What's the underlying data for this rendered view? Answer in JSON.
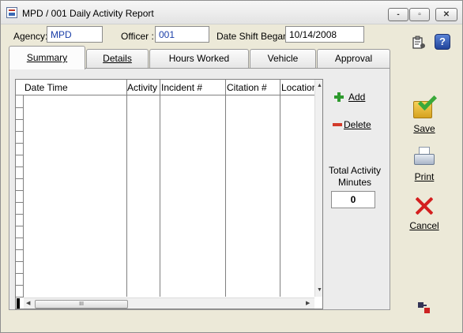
{
  "window": {
    "title": "MPD / 001 Daily Activity Report",
    "controls": {
      "minimize": "-",
      "maximize": "▫",
      "close": "✕"
    }
  },
  "header": {
    "agency_label": "Agency:",
    "agency_value": "MPD",
    "officer_label": "Officer :",
    "officer_value": "001",
    "date_label": "Date Shift Began :",
    "date_value": "10/14/2008"
  },
  "tabs": [
    {
      "label": "Summary",
      "active": true
    },
    {
      "label": "Details"
    },
    {
      "label": "Hours Worked"
    },
    {
      "label": "Vehicle"
    },
    {
      "label": "Approval"
    }
  ],
  "grid": {
    "columns": [
      "Date  Time",
      "Activity",
      "Incident #",
      "Citation #",
      "Location"
    ],
    "rows": [],
    "hscroll_thumb": "III"
  },
  "actions": {
    "add_label": "Add",
    "delete_label": "Delete"
  },
  "totals": {
    "label": "Total Activity Minutes",
    "value": "0"
  },
  "toolbar": {
    "save_label": "Save",
    "print_label": "Print",
    "cancel_label": "Cancel"
  },
  "icons": {
    "app": "app-icon",
    "clipboard": "clipboard-settings-icon",
    "help": "help-icon",
    "save": "save-icon",
    "print": "printer-icon",
    "cancel": "cancel-icon",
    "swap": "swap-icon"
  }
}
